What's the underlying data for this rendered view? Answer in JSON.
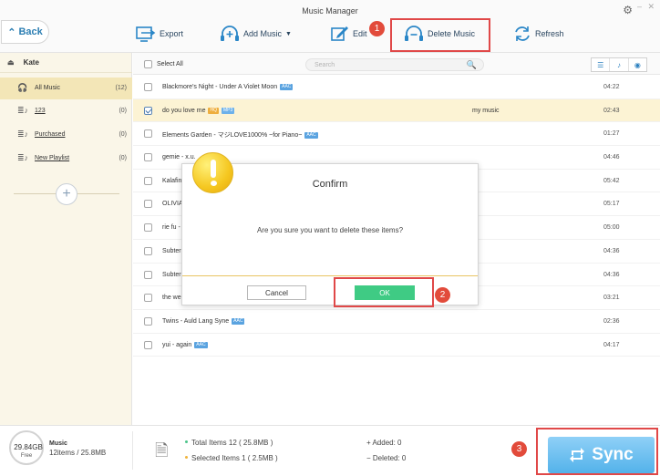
{
  "app": {
    "title": "Music Manager"
  },
  "toolbar": {
    "back_label": "Back",
    "export_label": "Export",
    "add_music_label": "Add Music",
    "edit_label": "Edit",
    "delete_music_label": "Delete Music",
    "refresh_label": "Refresh"
  },
  "sidebar": {
    "device_name": "Kate",
    "items": [
      {
        "label": "All Music",
        "count": "(12)",
        "icon": "headphones-icon",
        "active": true
      },
      {
        "label": "123",
        "count": "(0)",
        "icon": "playlist-icon"
      },
      {
        "label": "Purchased",
        "count": "(0)",
        "icon": "playlist-icon"
      },
      {
        "label": "New Playlist",
        "count": "(0)",
        "icon": "playlist-icon"
      }
    ]
  },
  "list": {
    "select_all_label": "Select All",
    "search_placeholder": "Search",
    "rows": [
      {
        "title": "Blackmore's Night - Under A Violet Moon",
        "badges": [
          "AAC"
        ],
        "album": "",
        "duration": "04:22",
        "checked": false
      },
      {
        "title": "do you love me",
        "badges": [
          "HQ",
          "MP3"
        ],
        "album": "my music",
        "duration": "02:43",
        "checked": true
      },
      {
        "title": "Elements Garden - マジLOVE1000% ~for Piano~",
        "badges": [
          "AAC"
        ],
        "album": "",
        "duration": "01:27",
        "checked": false
      },
      {
        "title": "gemie - x.u.",
        "badges": [],
        "album": "",
        "duration": "04:46",
        "checked": false
      },
      {
        "title": "Kalafin",
        "badges": [],
        "album": "",
        "duration": "05:42",
        "checked": false
      },
      {
        "title": "OLIVIA",
        "badges": [],
        "album": "",
        "duration": "05:17",
        "checked": false
      },
      {
        "title": "rie fu -",
        "badges": [],
        "album": "",
        "duration": "05:00",
        "checked": false
      },
      {
        "title": "Subter",
        "badges": [],
        "album": "",
        "duration": "04:36",
        "checked": false
      },
      {
        "title": "Subter",
        "badges": [],
        "album": "",
        "duration": "04:36",
        "checked": false
      },
      {
        "title": "the we",
        "badges": [],
        "album": "",
        "duration": "03:21",
        "checked": false
      },
      {
        "title": "Twins - Auld Lang Syne",
        "badges": [
          "AAC"
        ],
        "album": "",
        "duration": "02:36",
        "checked": false
      },
      {
        "title": "yui - again",
        "badges": [
          "AAC"
        ],
        "album": "",
        "duration": "04:17",
        "checked": false
      }
    ]
  },
  "status": {
    "free_size": "29.84GB",
    "free_label": "Free",
    "music_label": "Music",
    "music_info": "12items / 25.8MB",
    "total_items": "Total Items 12 ( 25.8MB )",
    "selected_items": "Selected Items 1 ( 2.5MB )",
    "added": "Added: 0",
    "deleted": "Deleted: 0",
    "sync_label": "Sync"
  },
  "dialog": {
    "title": "Confirm",
    "message": "Are you sure you want to delete these items?",
    "cancel_label": "Cancel",
    "ok_label": "OK"
  },
  "markers": [
    "1",
    "2",
    "3"
  ],
  "colors": {
    "accent": "#2d7fb3",
    "highlight": "#e04848",
    "ok_green": "#3fcb84",
    "sync_blue": "#53b2ea",
    "sidebar_bg": "#faf6e8"
  }
}
